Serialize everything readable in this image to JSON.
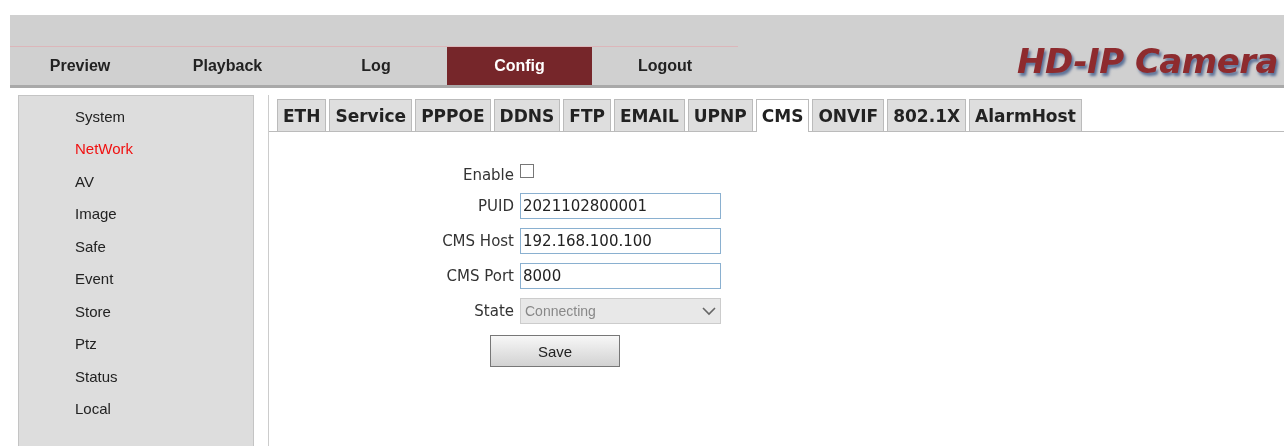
{
  "nav": [
    {
      "label": "Preview",
      "selected": false
    },
    {
      "label": "Playback",
      "selected": false
    },
    {
      "label": "Log",
      "selected": false
    },
    {
      "label": "Config",
      "selected": true
    },
    {
      "label": "Logout",
      "selected": false
    }
  ],
  "logo": "HD-IP Camera",
  "sidebar": {
    "items": [
      {
        "label": "System",
        "selected": false
      },
      {
        "label": "NetWork",
        "selected": true
      },
      {
        "label": "AV",
        "selected": false
      },
      {
        "label": "Image",
        "selected": false
      },
      {
        "label": "Safe",
        "selected": false
      },
      {
        "label": "Event",
        "selected": false
      },
      {
        "label": "Store",
        "selected": false
      },
      {
        "label": "Ptz",
        "selected": false
      },
      {
        "label": "Status",
        "selected": false
      },
      {
        "label": "Local",
        "selected": false
      }
    ]
  },
  "tabs": [
    {
      "label": "ETH",
      "selected": false
    },
    {
      "label": "Service",
      "selected": false
    },
    {
      "label": "PPPOE",
      "selected": false
    },
    {
      "label": "DDNS",
      "selected": false
    },
    {
      "label": "FTP",
      "selected": false
    },
    {
      "label": "EMAIL",
      "selected": false
    },
    {
      "label": "UPNP",
      "selected": false
    },
    {
      "label": "CMS",
      "selected": true
    },
    {
      "label": "ONVIF",
      "selected": false
    },
    {
      "label": "802.1X",
      "selected": false
    },
    {
      "label": "AlarmHost",
      "selected": false
    }
  ],
  "form": {
    "fields": [
      {
        "kind": "checkbox",
        "label": "Enable",
        "checked": false
      },
      {
        "kind": "text",
        "label": "PUID",
        "value": "2021102800001"
      },
      {
        "kind": "text",
        "label": "CMS Host",
        "value": "192.168.100.100"
      },
      {
        "kind": "text",
        "label": "CMS Port",
        "value": "8000"
      },
      {
        "kind": "select",
        "label": "State",
        "value": "Connecting",
        "disabled": true
      }
    ],
    "save_button": "Save"
  }
}
